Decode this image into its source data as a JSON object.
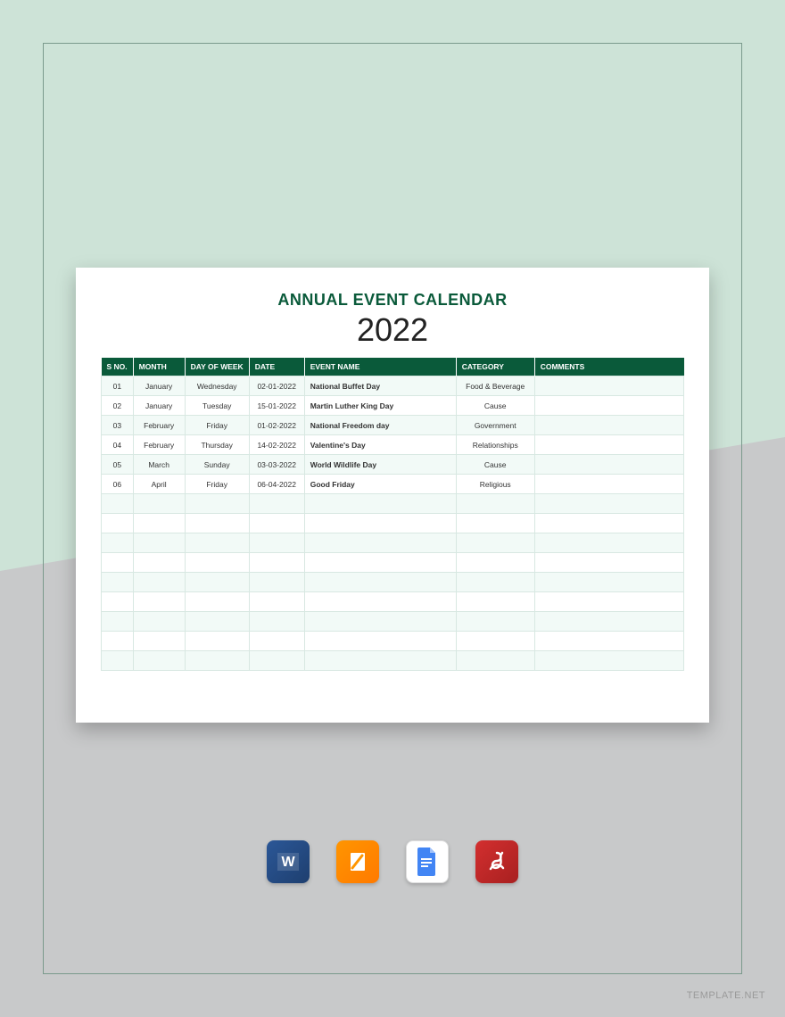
{
  "title": "ANNUAL EVENT CALENDAR",
  "year": "2022",
  "headers": {
    "sno": "S NO.",
    "month": "MONTH",
    "dow": "DAY OF WEEK",
    "date": "DATE",
    "event": "EVENT NAME",
    "category": "CATEGORY",
    "comments": "COMMENTS"
  },
  "rows": [
    {
      "sno": "01",
      "month": "January",
      "dow": "Wednesday",
      "date": "02-01-2022",
      "event": "National Buffet Day",
      "category": "Food & Beverage",
      "comments": ""
    },
    {
      "sno": "02",
      "month": "January",
      "dow": "Tuesday",
      "date": "15-01-2022",
      "event": "Martin Luther King Day",
      "category": "Cause",
      "comments": ""
    },
    {
      "sno": "03",
      "month": "February",
      "dow": "Friday",
      "date": "01-02-2022",
      "event": "National Freedom day",
      "category": "Government",
      "comments": ""
    },
    {
      "sno": "04",
      "month": "February",
      "dow": "Thursday",
      "date": "14-02-2022",
      "event": "Valentine's Day",
      "category": "Relationships",
      "comments": ""
    },
    {
      "sno": "05",
      "month": "March",
      "dow": "Sunday",
      "date": "03-03-2022",
      "event": "World Wildlife Day",
      "category": "Cause",
      "comments": ""
    },
    {
      "sno": "06",
      "month": "April",
      "dow": "Friday",
      "date": "06-04-2022",
      "event": "Good Friday",
      "category": "Religious",
      "comments": ""
    }
  ],
  "empty_rows": 9,
  "watermark": "TEMPLATE.NET",
  "icons": {
    "word": "W",
    "pages": "pages-icon",
    "gdocs": "gdocs-icon",
    "pdf": "pdf-icon"
  }
}
